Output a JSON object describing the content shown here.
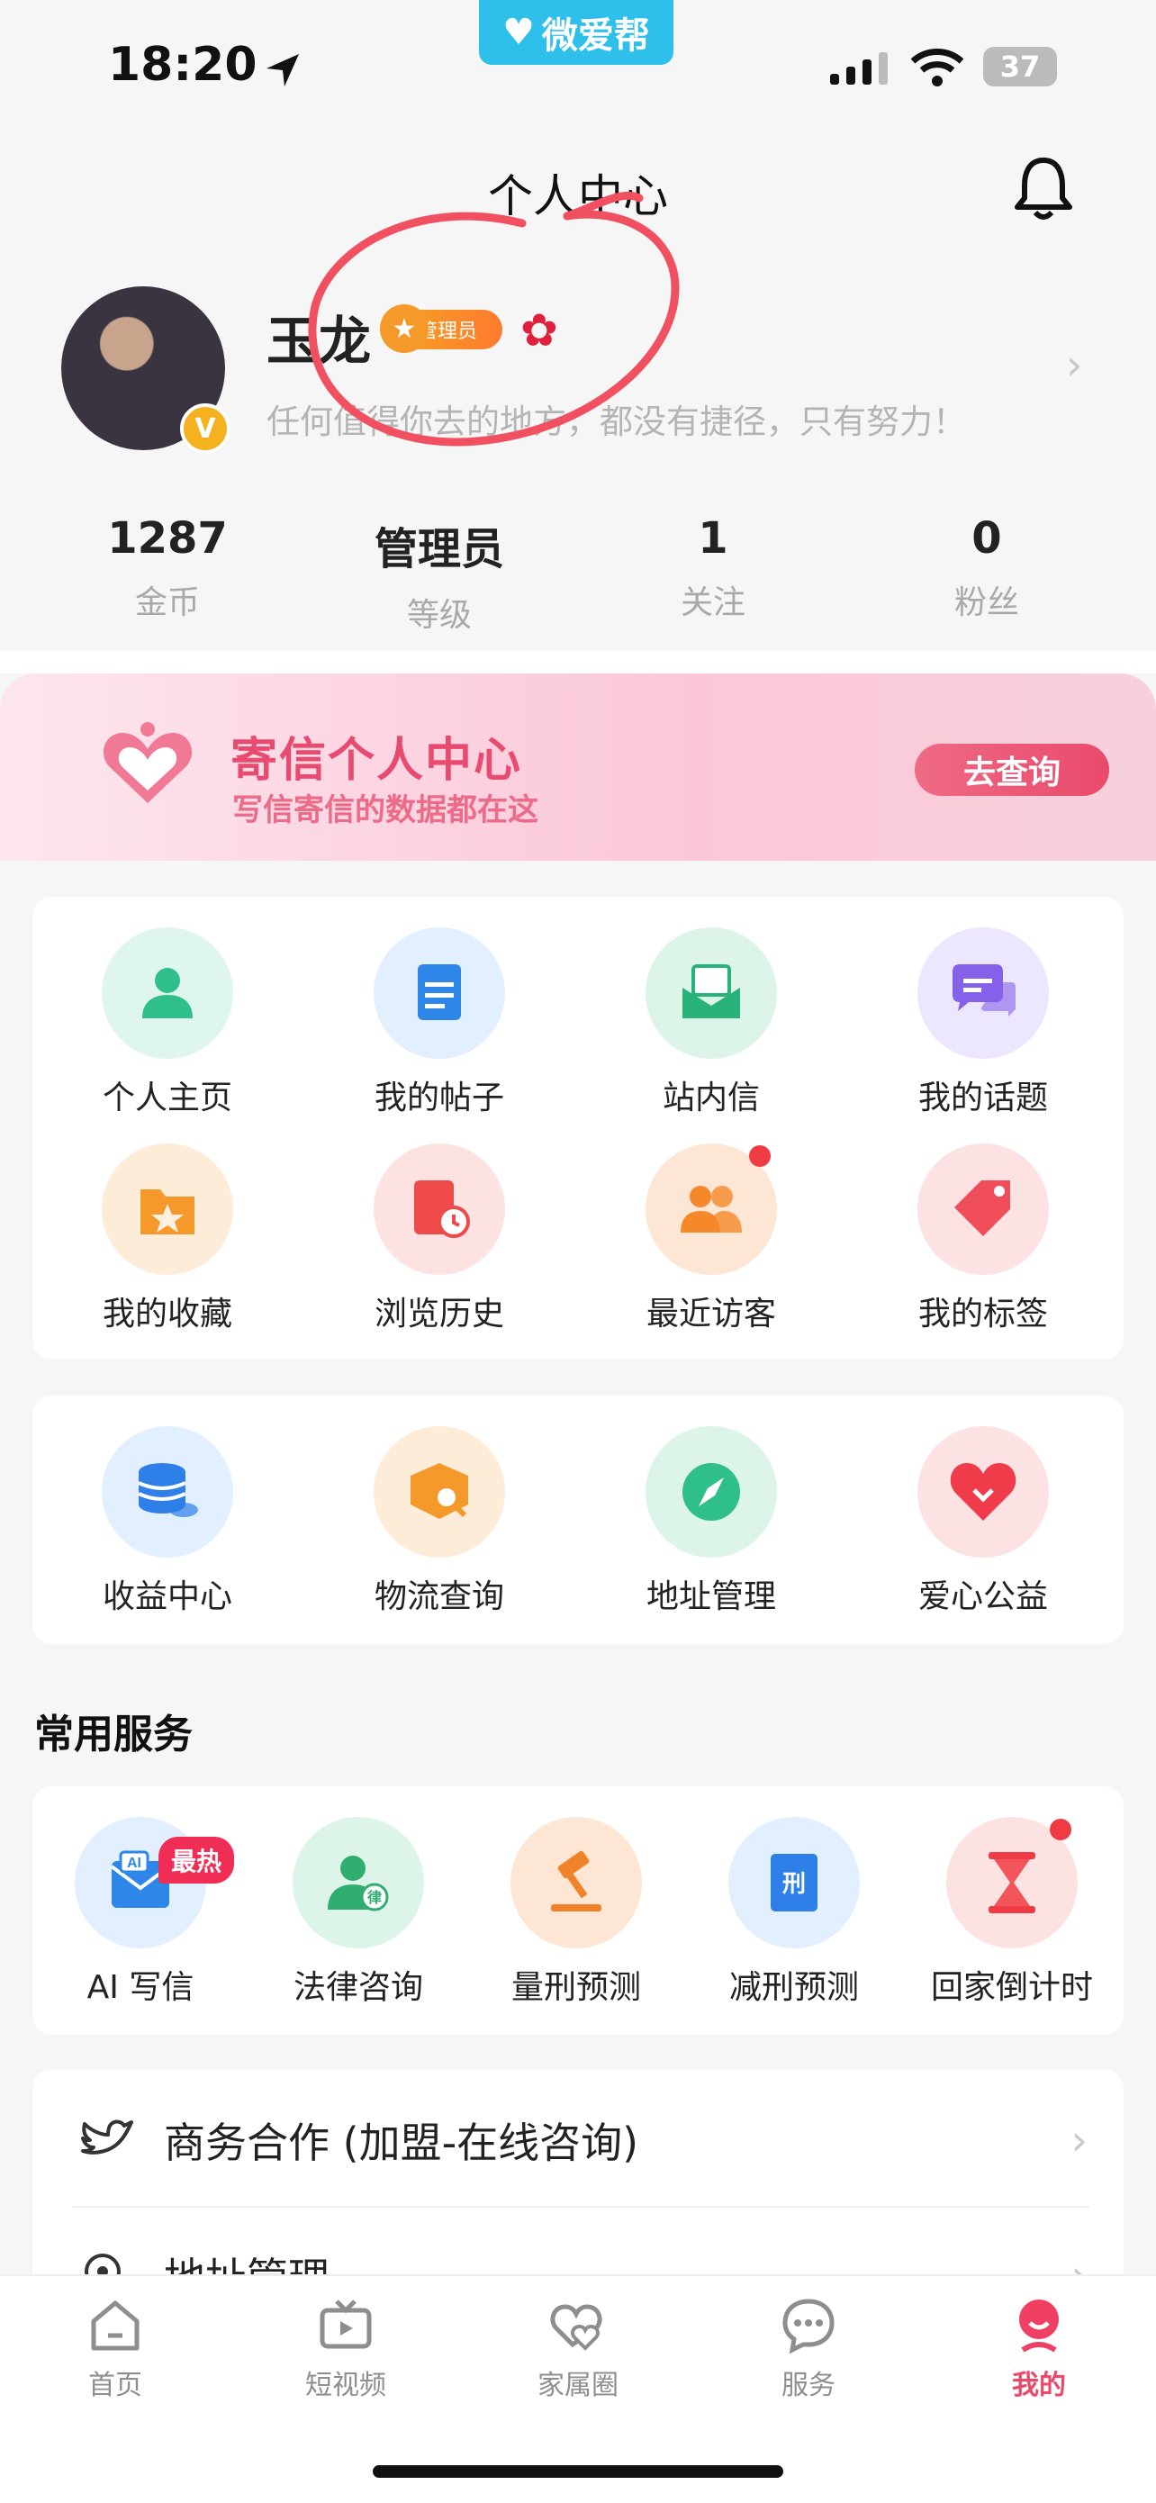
{
  "status_bar": {
    "time": "18:20",
    "app_name": "微爱帮",
    "battery": "37"
  },
  "header": {
    "title": "个人中心"
  },
  "profile": {
    "name": "玉龙",
    "role_badge": "管理员",
    "verified": "V",
    "motto": "任何值得你去的地方，都没有捷径，只有努力！"
  },
  "stats": [
    {
      "value": "1287",
      "label": "金币"
    },
    {
      "value": "管理员",
      "label": "等级"
    },
    {
      "value": "1",
      "label": "关注"
    },
    {
      "value": "0",
      "label": "粉丝"
    }
  ],
  "banner": {
    "title": "寄信个人中心",
    "subtitle": "写信寄信的数据都在这",
    "button": "去查询"
  },
  "grid1": [
    {
      "label": "个人主页",
      "icon": "user-icon",
      "color": "#2fbf8a",
      "bg": "#dff6ec"
    },
    {
      "label": "我的帖子",
      "icon": "post-icon",
      "color": "#2e86e8",
      "bg": "#e1efff"
    },
    {
      "label": "站内信",
      "icon": "mail-icon",
      "color": "#27b37a",
      "bg": "#ddf4e9"
    },
    {
      "label": "我的话题",
      "icon": "chat-icon",
      "color": "#8560e8",
      "bg": "#ece6ff"
    },
    {
      "label": "我的收藏",
      "icon": "star-folder-icon",
      "color": "#f59a2a",
      "bg": "#fdecd8"
    },
    {
      "label": "浏览历史",
      "icon": "history-icon",
      "color": "#ee4a4a",
      "bg": "#fde2e2"
    },
    {
      "label": "最近访客",
      "icon": "visitors-icon",
      "color": "#f5892a",
      "bg": "#fde6d4"
    },
    {
      "label": "我的标签",
      "icon": "tag-icon",
      "color": "#ef4d5a",
      "bg": "#fde2e4"
    }
  ],
  "grid2": [
    {
      "label": "收益中心",
      "icon": "coins-icon",
      "color": "#2e7fe8",
      "bg": "#e1efff"
    },
    {
      "label": "物流查询",
      "icon": "package-search-icon",
      "color": "#f59a2a",
      "bg": "#fdecd8"
    },
    {
      "label": "地址管理",
      "icon": "compass-icon",
      "color": "#2fbf8a",
      "bg": "#ddf4e9"
    },
    {
      "label": "爱心公益",
      "icon": "heart-icon",
      "color": "#ef3b4a",
      "bg": "#fde2e4"
    }
  ],
  "services_title": "常用服务",
  "services": [
    {
      "label": "AI 写信",
      "icon": "ai-letter-icon",
      "color": "#2e86e8",
      "bg": "#e1efff",
      "badge": "最热"
    },
    {
      "label": "法律咨询",
      "icon": "lawyer-icon",
      "color": "#2fae70",
      "bg": "#ddf4e9"
    },
    {
      "label": "量刑预测",
      "icon": "gavel-icon",
      "color": "#f0822a",
      "bg": "#fde6d4"
    },
    {
      "label": "减刑预测",
      "icon": "book-icon",
      "color": "#2e7fe8",
      "bg": "#e1efff",
      "glyph": "刑"
    },
    {
      "label": "回家倒计时",
      "icon": "hourglass-icon",
      "color": "#ef3b43",
      "bg": "#fde2e2"
    }
  ],
  "list": [
    {
      "label": "商务合作 (加盟-在线咨询)",
      "icon": "bird-icon"
    },
    {
      "label": "地址管理",
      "icon": "location-icon"
    }
  ],
  "tabs": [
    {
      "label": "首页",
      "icon": "home-icon"
    },
    {
      "label": "短视频",
      "icon": "tv-icon"
    },
    {
      "label": "家属圈",
      "icon": "hearts-icon"
    },
    {
      "label": "服务",
      "icon": "message-icon"
    },
    {
      "label": "我的",
      "icon": "me-icon",
      "active": "true"
    }
  ],
  "colors": {
    "accent": "#e94a6a",
    "annotation": "#f0505f"
  }
}
